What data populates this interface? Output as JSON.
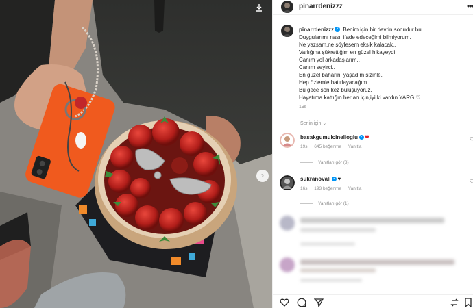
{
  "post": {
    "username": "pinarrdenizzz",
    "caption_lines": [
      "Benim için bir devrin sonudur bu.",
      "Duygularımı nasıl ifade edeceğimi bilmiyorum.",
      "Ne yazsam,ne söylesem eksik kalacak..",
      "Varlığına şükrettiğim en güzel hikayeydi.",
      "Canım yol arkadaşlarım..",
      "Canım seyirci..",
      "En güzel baharını yaşadım sizinle.",
      "Hep özlemle hatırlayacağım.",
      "Bu gece son kez buluşuyoruz.",
      "Hayatıma kattığın her an için,iyi ki vardın YARGI♡"
    ],
    "time": "19s",
    "see_translation": "Senin için",
    "verified_mark": "✓",
    "more_icon": "•••"
  },
  "comments": [
    {
      "username": "basakgumulcinelioglu",
      "emoji": "❤",
      "time": "19s",
      "likes": "645 beğenme",
      "reply": "Yanıtla",
      "view_replies": "Yanıtları gör (3)"
    },
    {
      "username": "sukranovali",
      "emoji": "♥",
      "time": "16s",
      "likes": "193 beğenme",
      "reply": "Yanıtla",
      "view_replies": "Yanıtları gör (1)"
    }
  ],
  "icons": {
    "like": "heart-outline-icon",
    "comment": "comment-icon",
    "share": "send-icon",
    "save": "bookmark-icon"
  },
  "colors": {
    "verified": "#0095f6",
    "phone_case": "#f05a1e",
    "strawberry": "#c42a22"
  }
}
